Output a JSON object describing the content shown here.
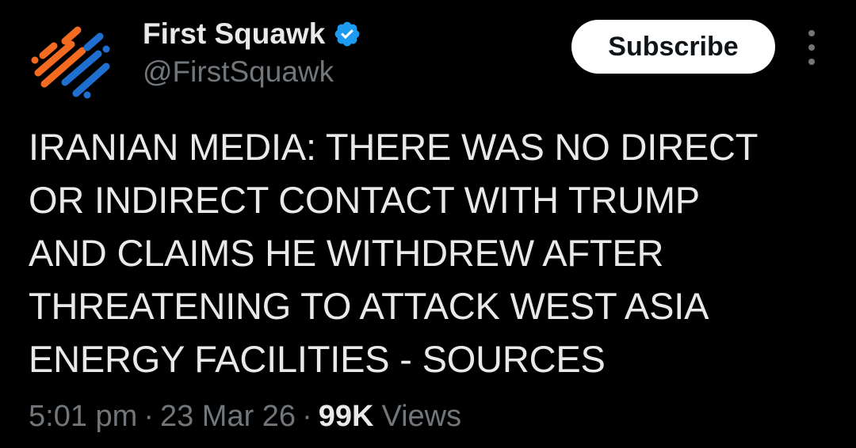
{
  "account": {
    "display_name": "First Squawk",
    "handle": "@FirstSquawk",
    "verified": true,
    "avatar_icon": "first-squawk-logo-icon",
    "verified_icon": "verified-badge-icon",
    "verified_color": "#1d9bf0"
  },
  "actions": {
    "subscribe_label": "Subscribe",
    "more_icon": "more-vertical-icon"
  },
  "tweet": {
    "text": "IRANIAN MEDIA: THERE WAS NO DIRECT\nOR INDIRECT CONTACT WITH TRUMP\nAND CLAIMS HE WITHDREW AFTER\nTHREATENING TO ATTACK WEST ASIA\nENERGY FACILITIES - SOURCES"
  },
  "meta": {
    "time": "5:01 pm",
    "separator": "·",
    "date": "23 Mar 26",
    "views_count": "99K",
    "views_label": "Views"
  },
  "colors": {
    "background": "#000000",
    "primary_text": "#e7e9ea",
    "secondary_text": "#71767b",
    "logo_orange": "#f26b21",
    "logo_blue": "#1f6fd1"
  }
}
